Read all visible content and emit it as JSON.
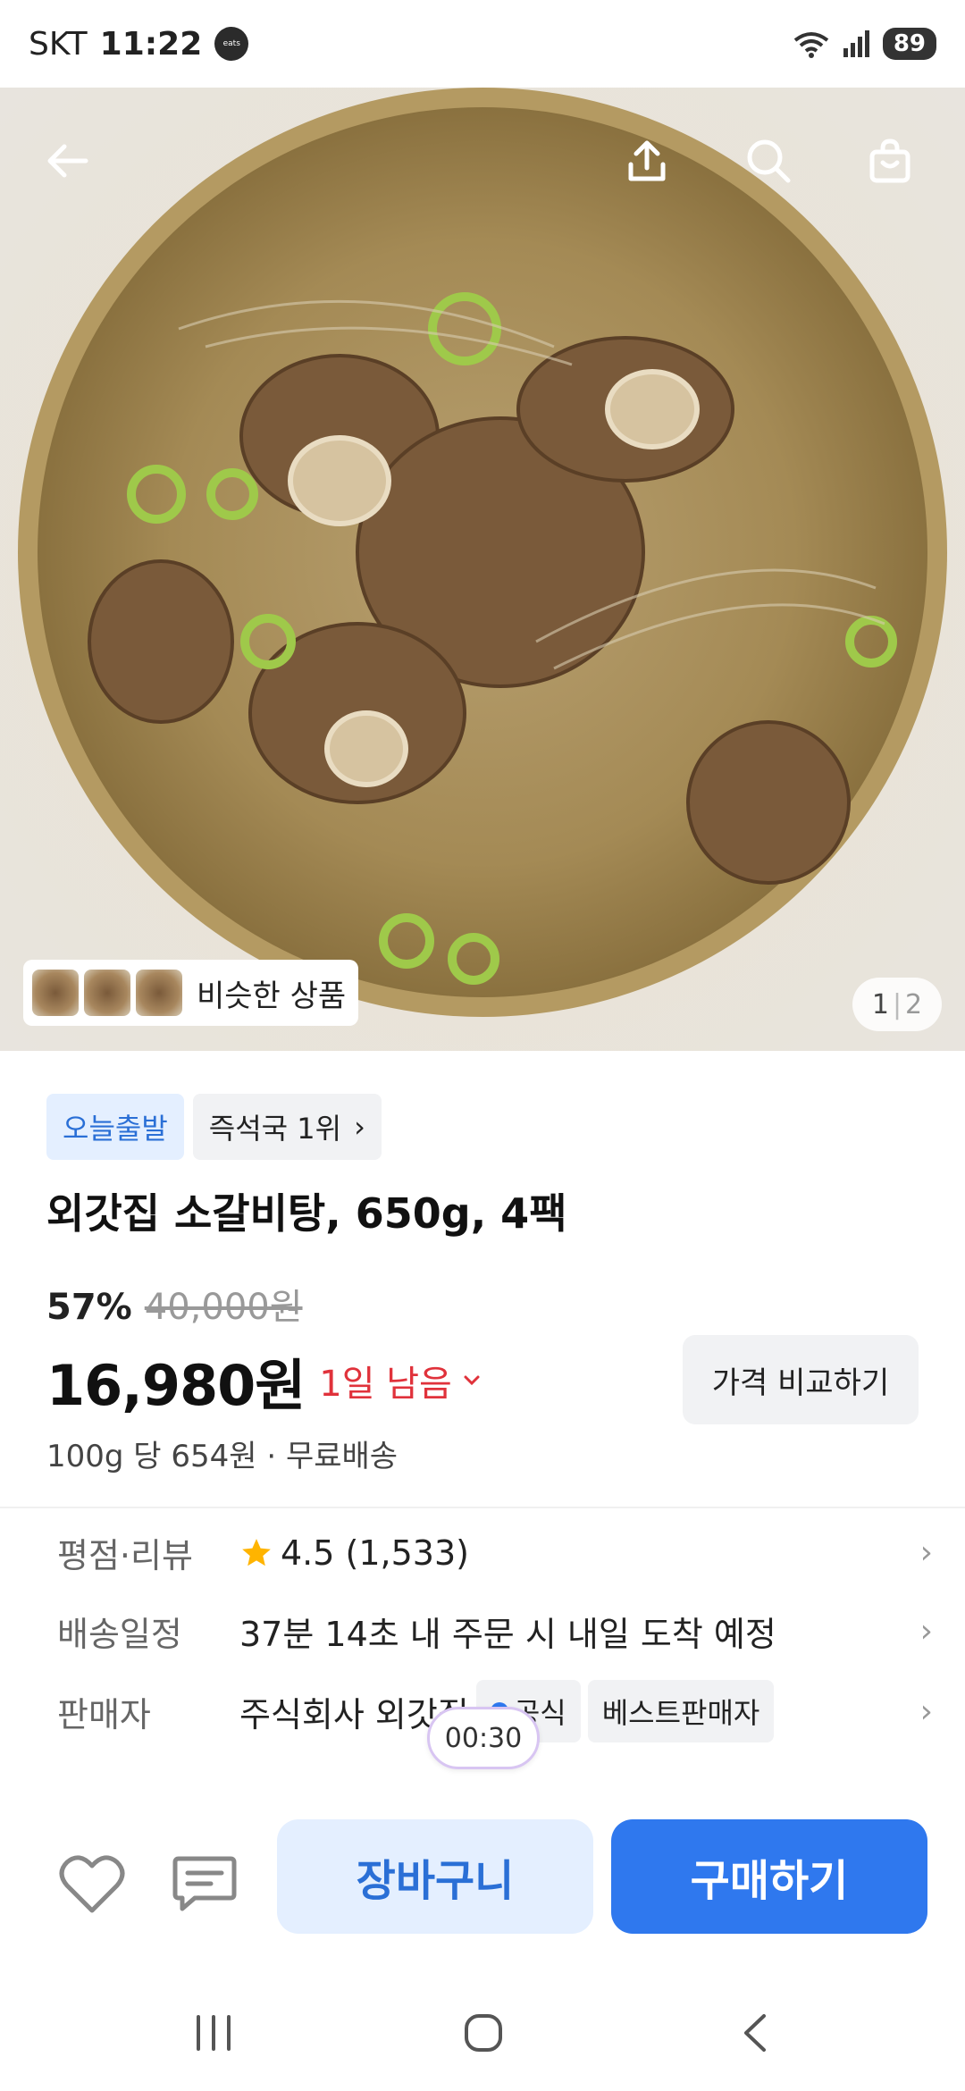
{
  "status_bar": {
    "carrier": "SKT",
    "time": "11:22",
    "app_badge": "coupang eats",
    "wifi_label": "6",
    "battery": "89"
  },
  "hero": {
    "similar_label": "비슷한 상품",
    "page_current": "1",
    "page_total": "2",
    "icons": [
      "back-arrow-icon",
      "share-icon",
      "search-icon",
      "shopping-bag-icon"
    ]
  },
  "badges": {
    "today": "오늘출발",
    "rank": "즉석국 1위",
    "rank_chevron": "›"
  },
  "product": {
    "title": "외갓집 소갈비탕, 650g, 4팩",
    "discount": "57%",
    "original_price": "40,000원",
    "price": "16,980원",
    "remaining": "1일 남음",
    "compare_label": "가격 비교하기",
    "unit_info": "100g 당 654원 · 무료배송"
  },
  "info": {
    "rating_label": "평점·리뷰",
    "rating_value": "4.5 (1,533)",
    "shipping_label": "배송일정",
    "shipping_value": "37분 14초 내 주문 시 내일 도착 예정",
    "seller_label": "판매자",
    "seller_value": "주식회사 외갓집",
    "seller_tag_official": "공식",
    "seller_tag_best": "베스트판매자",
    "chevron": "›"
  },
  "timer": "00:30",
  "actions": {
    "cart": "장바구니",
    "buy": "구매하기"
  },
  "colors": {
    "primary_blue": "#2f78ee",
    "light_blue": "#e4efff",
    "accent_red": "#e0323b",
    "star": "#ffb400"
  }
}
